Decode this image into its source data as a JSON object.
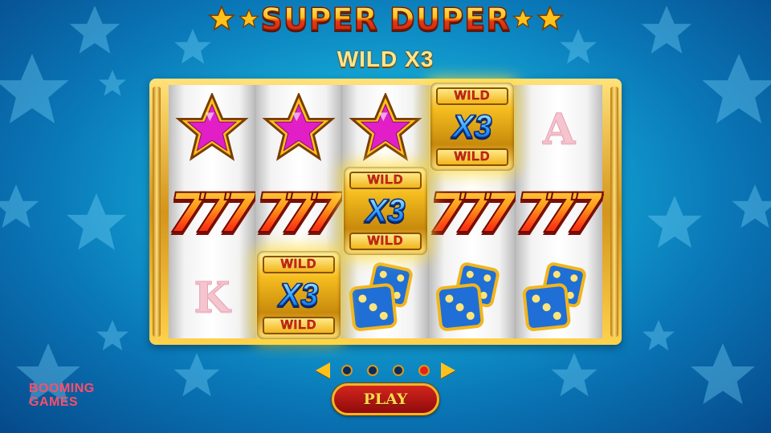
{
  "header": {
    "title": "SUPER DUPER",
    "subtitle": "WILD X3"
  },
  "reels": [
    [
      "star",
      "sevens",
      "K"
    ],
    [
      "star",
      "sevens",
      "wild"
    ],
    [
      "star",
      "wild",
      "dice"
    ],
    [
      "wild",
      "sevens",
      "dice"
    ],
    [
      "A",
      "sevens",
      "dice"
    ]
  ],
  "symbols": {
    "sevens_text": "777",
    "letter_k": "K",
    "letter_a": "A",
    "wild_band_top": "WILD",
    "wild_multiplier": "X3",
    "wild_band_bottom": "WILD"
  },
  "pager": {
    "page_count": 4,
    "active_page": 4
  },
  "play_button": {
    "label": "PLAY"
  },
  "brand": {
    "line1": "BOOMING",
    "line2": "GAMES"
  },
  "colors": {
    "star_fill": "#e21fc6",
    "gold": "#ffc21a",
    "dice_blue": "#1f6fd6"
  }
}
